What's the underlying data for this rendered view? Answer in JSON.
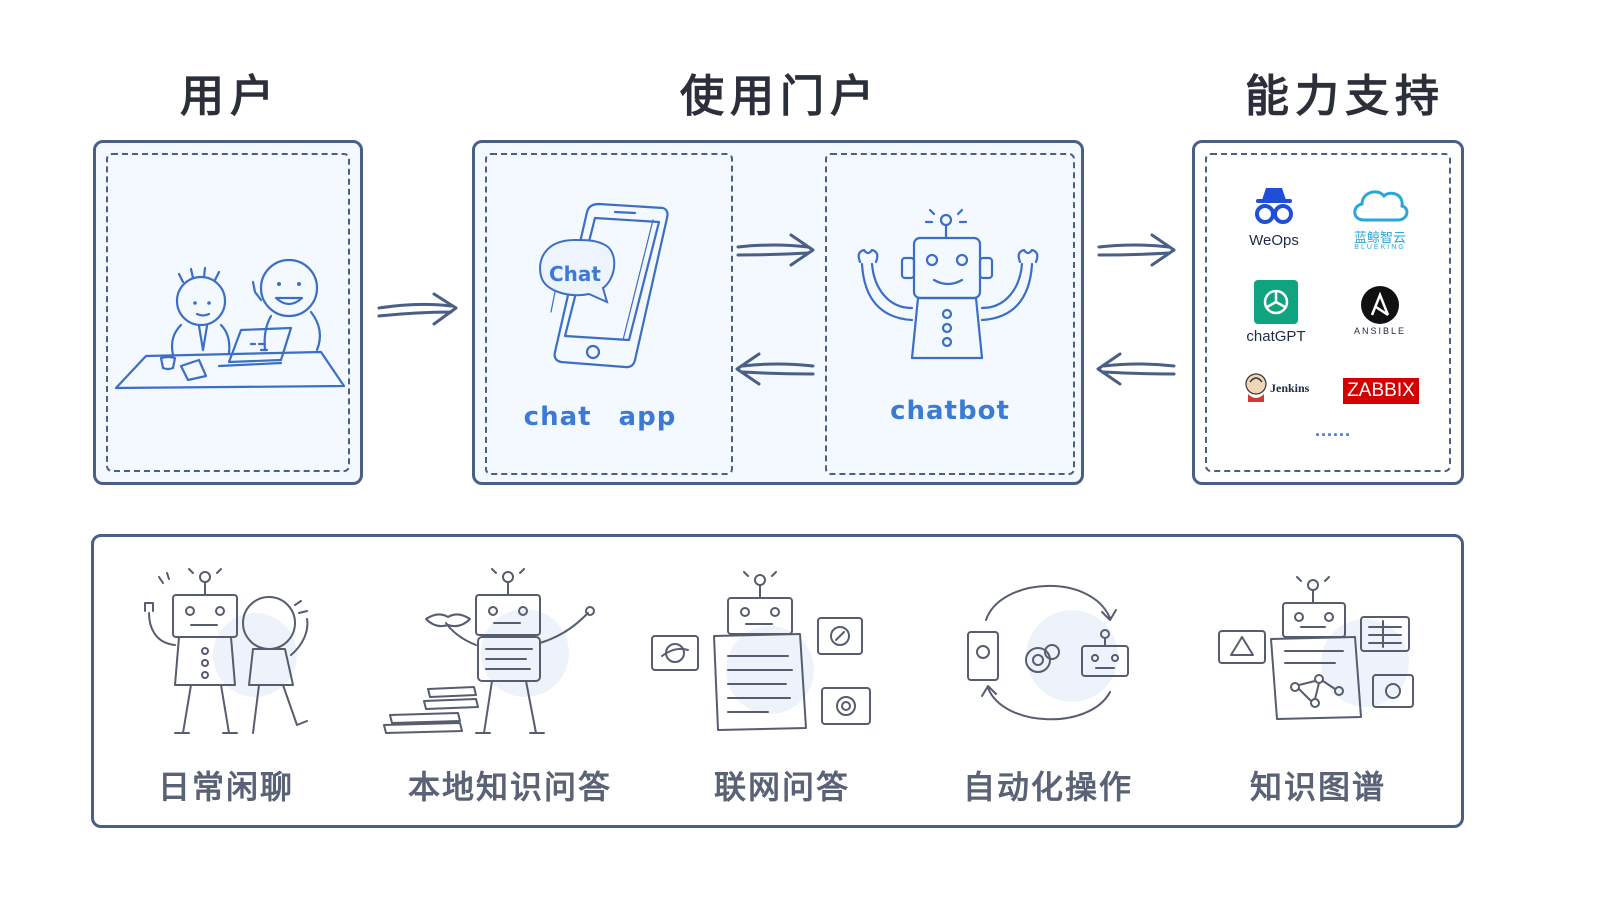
{
  "headings": {
    "user": "用户",
    "portal": "使用门户",
    "capability": "能力支持"
  },
  "portal": {
    "bubble_text": "Chat",
    "chat_app_label": "chat　app",
    "chatbot_label": "chatbot"
  },
  "capabilities": {
    "weops": "WeOps",
    "blueking_cn": "蓝鲸智云",
    "blueking_en": "BLUEKING",
    "chatgpt": "chatGPT",
    "ansible": "ANSIBLE",
    "jenkins": "Jenkins",
    "zabbix": "ZABBIX",
    "more": "......"
  },
  "features": [
    {
      "label": "日常闲聊"
    },
    {
      "label": "本地知识问答"
    },
    {
      "label": "联网问答"
    },
    {
      "label": "自动化操作"
    },
    {
      "label": "知识图谱"
    }
  ],
  "colors": {
    "panel_border": "#4a5f86",
    "panel_fill": "#f4f8ff",
    "sketch_blue": "#3b7bd6",
    "weops_blue": "#1f4fd8",
    "blueking_cyan": "#2aa7d8",
    "chatgpt_green": "#10a37f",
    "zabbix_red": "#d40000"
  }
}
